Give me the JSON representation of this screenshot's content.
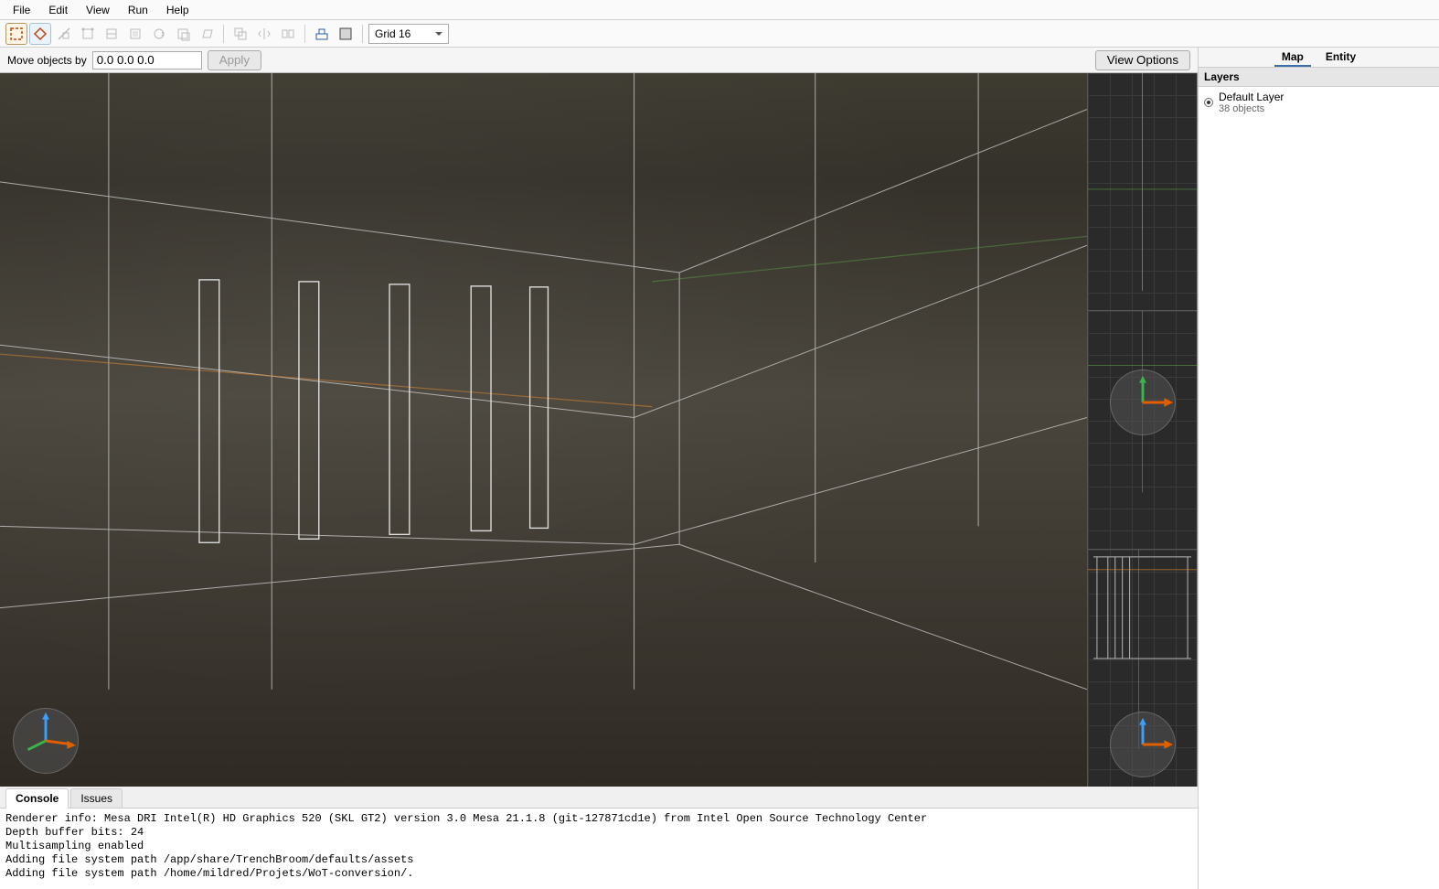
{
  "menu": {
    "items": [
      "File",
      "Edit",
      "View",
      "Run",
      "Help"
    ]
  },
  "toolbar": {
    "grid_label": "Grid 16"
  },
  "subbar": {
    "move_label": "Move objects by",
    "move_value": "0.0 0.0 0.0",
    "apply_label": "Apply",
    "view_options_label": "View Options"
  },
  "right_panel": {
    "tabs": [
      "Map",
      "Entity"
    ],
    "layers_header": "Layers",
    "layer": {
      "name": "Default Layer",
      "detail": "38 objects"
    }
  },
  "bottom_tabs": {
    "items": [
      "Console",
      "Issues"
    ],
    "active": 0
  },
  "console": {
    "lines": [
      "Renderer info: Mesa DRI Intel(R) HD Graphics 520 (SKL GT2) version 3.0 Mesa 21.1.8 (git-127871cd1e) from Intel Open Source Technology Center",
      "Depth buffer bits: 24",
      "Multisampling enabled",
      "Adding file system path /app/share/TrenchBroom/defaults/assets",
      "Adding file system path /home/mildred/Projets/WoT-conversion/."
    ]
  }
}
